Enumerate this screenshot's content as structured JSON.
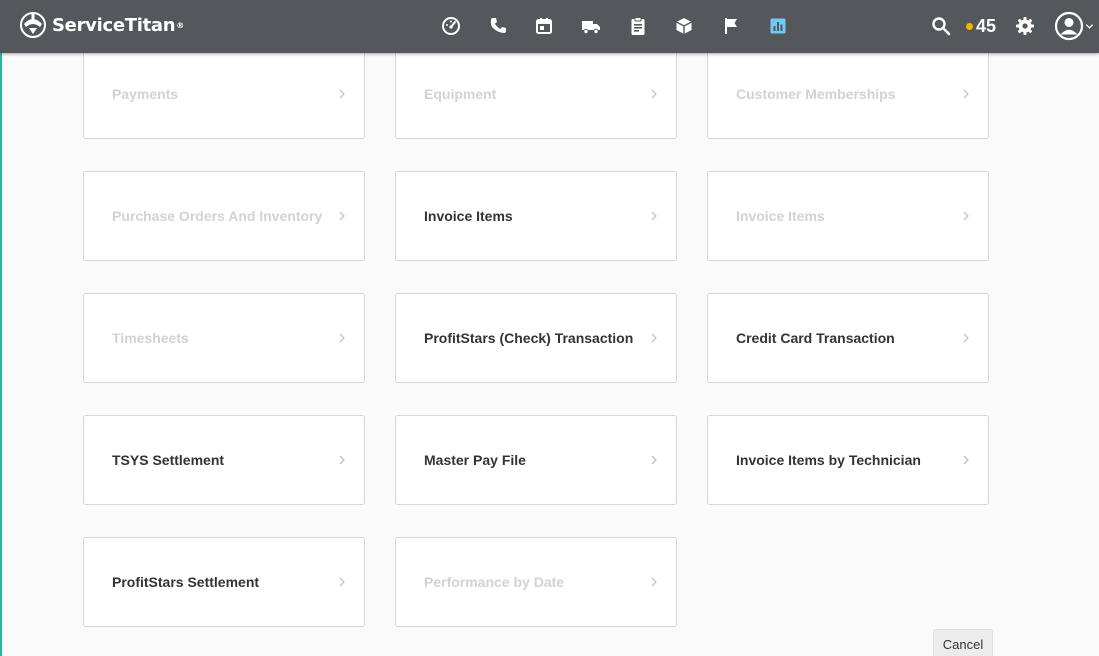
{
  "brand": {
    "name": "ServiceTitan",
    "trademark": "®",
    "header_color": "#54585c",
    "accent_color": "#27b6a6"
  },
  "nav": {
    "icons": [
      {
        "name": "dashboard-gauge-icon",
        "active": false
      },
      {
        "name": "phone-icon",
        "active": false
      },
      {
        "name": "calendar-icon",
        "active": false
      },
      {
        "name": "truck-icon",
        "active": false
      },
      {
        "name": "clipboard-icon",
        "active": false
      },
      {
        "name": "inventory-box-icon",
        "active": false
      },
      {
        "name": "flag-icon",
        "active": false
      },
      {
        "name": "reports-chart-icon",
        "active": true
      }
    ],
    "active_color": "#6ecbf5"
  },
  "tools": {
    "notification_count": "45",
    "notification_dot_color": "#f5b400"
  },
  "tiles": [
    {
      "label": "Payments",
      "enabled": false
    },
    {
      "label": "Equipment",
      "enabled": false
    },
    {
      "label": "Customer Memberships",
      "enabled": false
    },
    {
      "label": "Purchase Orders And Inventory",
      "enabled": false
    },
    {
      "label": "Invoice Items",
      "enabled": true
    },
    {
      "label": "Invoice Items",
      "enabled": false
    },
    {
      "label": "Timesheets",
      "enabled": false
    },
    {
      "label": "ProfitStars (Check) Transaction",
      "enabled": true
    },
    {
      "label": "Credit Card Transaction",
      "enabled": true
    },
    {
      "label": "TSYS Settlement",
      "enabled": true
    },
    {
      "label": "Master Pay File",
      "enabled": true
    },
    {
      "label": "Invoice Items by Technician",
      "enabled": true
    },
    {
      "label": "ProfitStars Settlement",
      "enabled": true
    },
    {
      "label": "Performance by Date",
      "enabled": false
    }
  ],
  "actions": {
    "cancel_label": "Cancel"
  }
}
